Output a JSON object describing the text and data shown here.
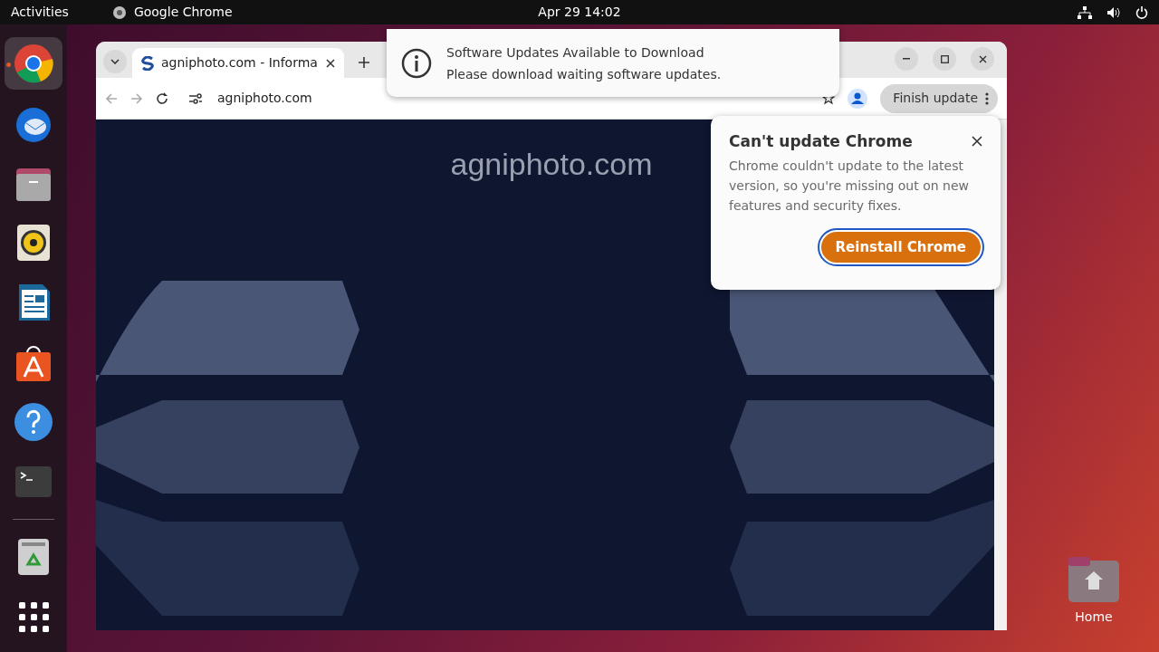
{
  "top_bar": {
    "activities": "Activities",
    "app_name": "Google Chrome",
    "clock": "Apr 29  14:02"
  },
  "dock": [
    {
      "kind": "chrome",
      "selected": true
    },
    {
      "kind": "mail",
      "selected": false
    },
    {
      "kind": "files",
      "selected": false
    },
    {
      "kind": "music",
      "selected": false
    },
    {
      "kind": "writer",
      "selected": false
    },
    {
      "kind": "store",
      "selected": false
    },
    {
      "kind": "help",
      "selected": false
    },
    {
      "kind": "terminal",
      "selected": false
    },
    {
      "kind": "trash",
      "selected": false
    },
    {
      "kind": "apps",
      "selected": false
    }
  ],
  "browser": {
    "tabs": [
      {
        "title": "agniphoto.com - Informa",
        "selected": true
      }
    ],
    "url": "agniphoto.com",
    "update_button": "Finish update",
    "page_heading": "agniphoto.com"
  },
  "update_popup": {
    "title": "Can't update Chrome",
    "body": "Chrome couldn't update to the latest version, so you're missing out on new features and security fixes.",
    "button": "Reinstall Chrome"
  },
  "notification": {
    "title": "Software Updates Available to Download",
    "body": "Please download waiting software updates."
  },
  "desktop_icons": [
    {
      "label": "Home"
    }
  ]
}
